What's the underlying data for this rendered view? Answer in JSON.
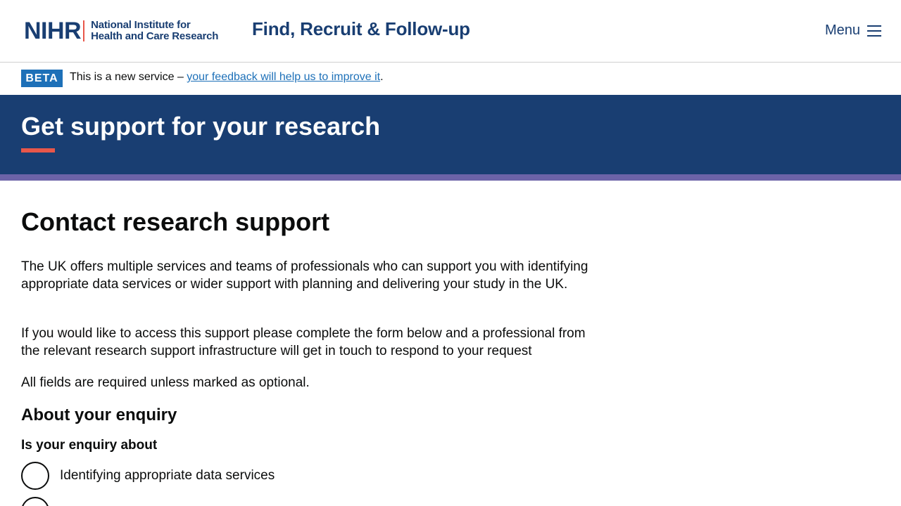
{
  "header": {
    "logo_mark": "NIHR",
    "logo_line1": "National Institute for",
    "logo_line2": "Health and Care Research",
    "service_name": "Find, Recruit & Follow-up",
    "menu_label": "Menu"
  },
  "beta_banner": {
    "tag": "BETA",
    "text_before": "This is a new service – ",
    "link_text": "your feedback will help us to improve it",
    "text_after": "."
  },
  "hero": {
    "title": "Get support for your research"
  },
  "main": {
    "heading": "Contact research support",
    "paragraph1": "The UK offers multiple services and teams of professionals who can support you with identifying appropriate data services or wider support with planning and delivering your study in the UK.",
    "paragraph2": "If you would like to access this support please complete the form below and a professional from the relevant research support infrastructure will get in touch to respond to your request",
    "paragraph3": "All fields are required unless marked as optional.",
    "section_heading": "About your enquiry",
    "question": "Is your enquiry about",
    "options": [
      {
        "label": "Identifying appropriate data services"
      },
      {
        "label": ""
      }
    ]
  },
  "colors": {
    "brand_navy": "#193e72",
    "accent_red": "#e8574a",
    "stripe_purple": "#6c63a8",
    "link_blue": "#1d70b8"
  }
}
